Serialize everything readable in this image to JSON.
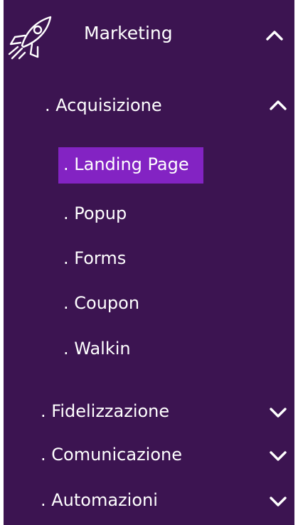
{
  "menu": {
    "section": {
      "label": "Marketing",
      "icon": "rocket-icon",
      "expanded": true
    },
    "groups": [
      {
        "label": ". Acquisizione",
        "expanded": true,
        "items": [
          {
            "label": ". Landing Page",
            "active": true
          },
          {
            "label": ". Popup",
            "active": false
          },
          {
            "label": ". Forms",
            "active": false
          },
          {
            "label": ". Coupon",
            "active": false
          },
          {
            "label": ". Walkin",
            "active": false
          }
        ]
      },
      {
        "label": ". Fidelizzazione",
        "expanded": false
      },
      {
        "label": ". Comunicazione",
        "expanded": false
      },
      {
        "label": ". Automazioni",
        "expanded": false
      }
    ]
  },
  "colors": {
    "background": "#3c1451",
    "active_item": "#8323c3",
    "text": "#ffffff"
  }
}
